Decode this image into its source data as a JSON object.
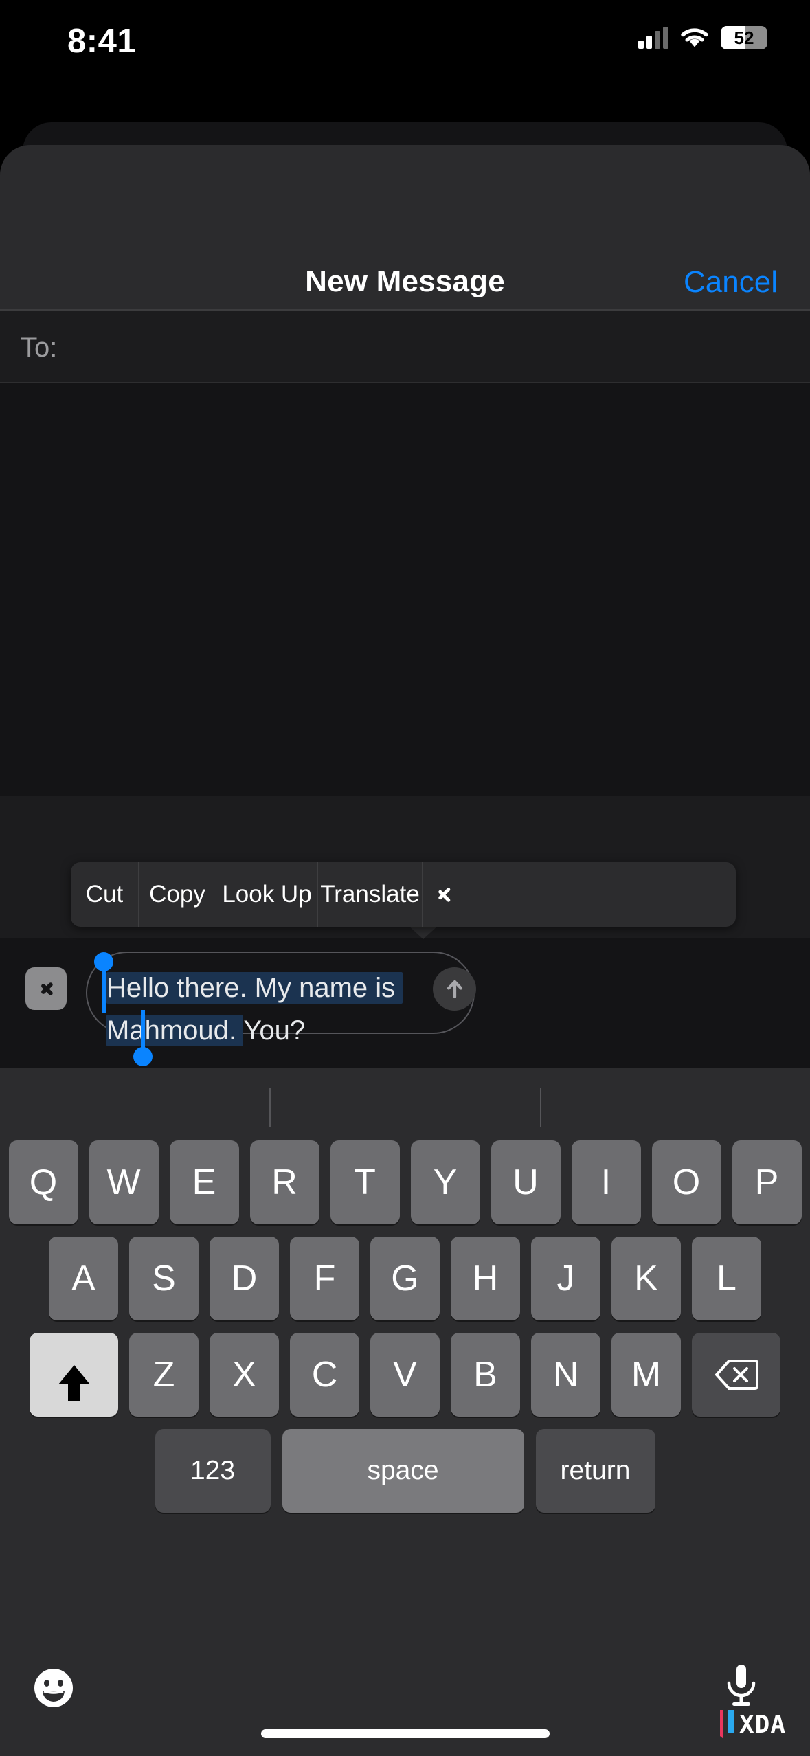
{
  "status_bar": {
    "time": "8:41",
    "battery_percent": "52",
    "battery_level": 52,
    "signal_icon": "cellular-bars-icon",
    "wifi_icon": "wifi-icon",
    "battery_icon": "battery-icon"
  },
  "nav": {
    "title": "New Message",
    "cancel_label": "Cancel",
    "cancel_color": "#0a84ff"
  },
  "recipient": {
    "label": "To:",
    "value": "",
    "placeholder": ""
  },
  "edit_menu": {
    "items": [
      {
        "label": "Cut",
        "name": "cut"
      },
      {
        "label": "Copy",
        "name": "copy"
      },
      {
        "label": "Look Up",
        "name": "look-up"
      },
      {
        "label": "Translate",
        "name": "translate"
      }
    ],
    "more_icon": "chevron-right-icon"
  },
  "input_bar": {
    "expand_icon": "chevron-right-icon",
    "send_icon": "arrow-up-icon",
    "text_selected": "Hello there. My name is Mahmoud. ",
    "text_unselected": "You?",
    "full_text": "Hello there. My name is Mahmoud. You?",
    "selection_color": "#1b3350",
    "handle_color": "#0a84ff"
  },
  "keyboard": {
    "row1": [
      "Q",
      "W",
      "E",
      "R",
      "T",
      "Y",
      "U",
      "I",
      "O",
      "P"
    ],
    "row2": [
      "A",
      "S",
      "D",
      "F",
      "G",
      "H",
      "J",
      "K",
      "L"
    ],
    "row3": [
      "Z",
      "X",
      "C",
      "V",
      "B",
      "N",
      "M"
    ],
    "shift_icon": "shift-arrow-icon",
    "backspace_icon": "backspace-icon",
    "numbers_label": "123",
    "space_label": "space",
    "return_label": "return",
    "emoji_icon": "emoji-smiley-icon",
    "dictation_icon": "microphone-icon"
  },
  "watermark": {
    "text": "XDA"
  }
}
